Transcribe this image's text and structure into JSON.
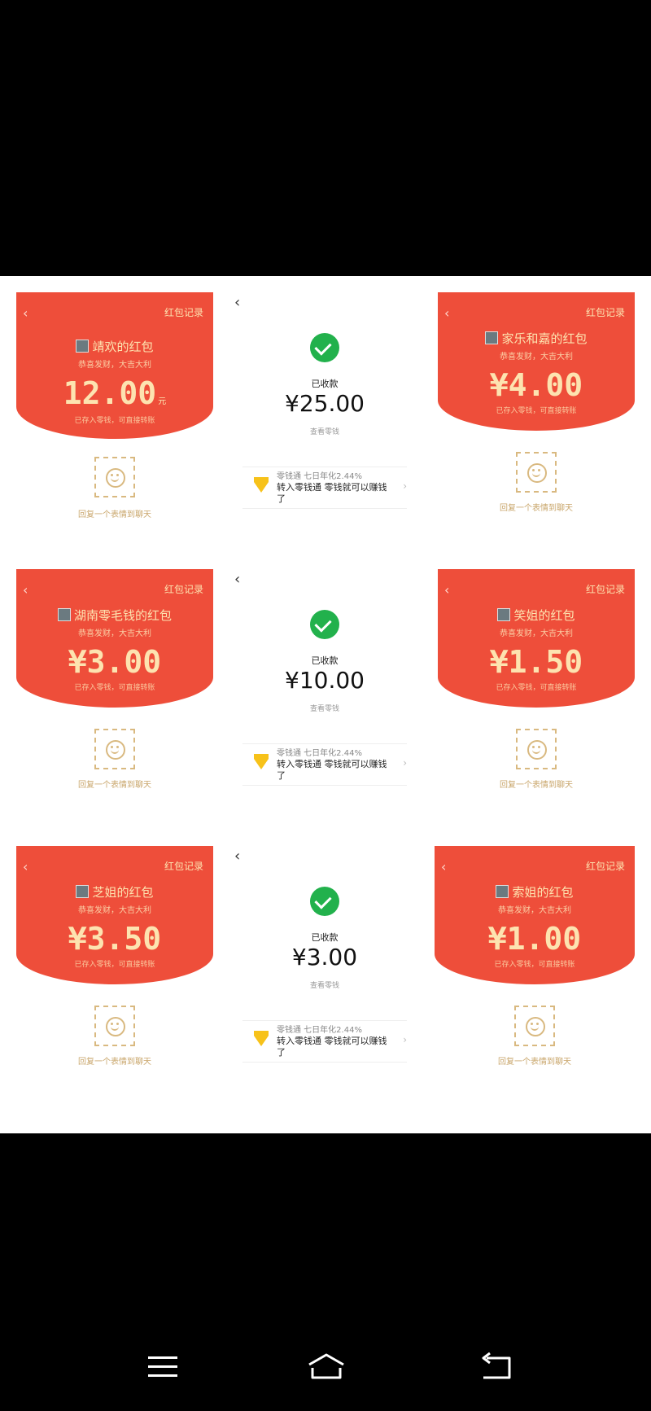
{
  "panels": [
    {
      "type": "red",
      "sender": "靖欢的红包",
      "wish": "恭喜发财，大吉大利",
      "amount": "12.00",
      "unit": "元",
      "note": "已存入零钱，可直接转账",
      "record": "红包记录",
      "sticker_text": "回复一个表情到聊天"
    },
    {
      "type": "received",
      "status": "已收款",
      "amount": "¥25.00",
      "view": "查看零钱",
      "promo_title": "零钱通 七日年化2.44%",
      "promo_text": "转入零钱通 零钱就可以赚钱了"
    },
    {
      "type": "red",
      "sender": "家乐和嘉的红包",
      "wish": "恭喜发财，大吉大利",
      "amount": "¥4.00",
      "note": "已存入零钱，可直接转账",
      "record": "红包记录",
      "sticker_text": "回复一个表情到聊天"
    },
    {
      "type": "red",
      "sender": "湖南零毛钱的红包",
      "wish": "恭喜发财，大吉大利",
      "amount": "¥3.00",
      "note": "已存入零钱，可直接转账",
      "record": "红包记录",
      "sticker_text": "回复一个表情到聊天"
    },
    {
      "type": "received",
      "status": "已收款",
      "amount": "¥10.00",
      "view": "查看零钱",
      "promo_title": "零钱通 七日年化2.44%",
      "promo_text": "转入零钱通 零钱就可以赚钱了"
    },
    {
      "type": "red",
      "sender": "笑姐的红包",
      "wish": "恭喜发财，大吉大利",
      "amount": "¥1.50",
      "note": "已存入零钱，可直接转账",
      "record": "红包记录",
      "sticker_text": "回复一个表情到聊天"
    },
    {
      "type": "red",
      "sender": "芝姐的红包",
      "wish": "恭喜发财，大吉大利",
      "amount": "¥3.50",
      "note": "已存入零钱，可直接转账",
      "record": "红包记录",
      "sticker_text": "回复一个表情到聊天"
    },
    {
      "type": "received",
      "status": "已收款",
      "amount": "¥3.00",
      "view": "查看零钱",
      "promo_title": "零钱通 七日年化2.44%",
      "promo_text": "转入零钱通 零钱就可以赚钱了"
    },
    {
      "type": "red",
      "sender": "索姐的红包",
      "wish": "恭喜发财，大吉大利",
      "amount": "¥1.00",
      "note": "已存入零钱，可直接转账",
      "record": "红包记录",
      "sticker_text": "回复一个表情到聊天"
    }
  ],
  "icons": {
    "back": "‹",
    "chevron": "›"
  },
  "colors": {
    "red_packet": "#ee4e3a",
    "gold_text": "#fde3b0",
    "success_green": "#22b14c",
    "diamond": "#f7c21a"
  }
}
